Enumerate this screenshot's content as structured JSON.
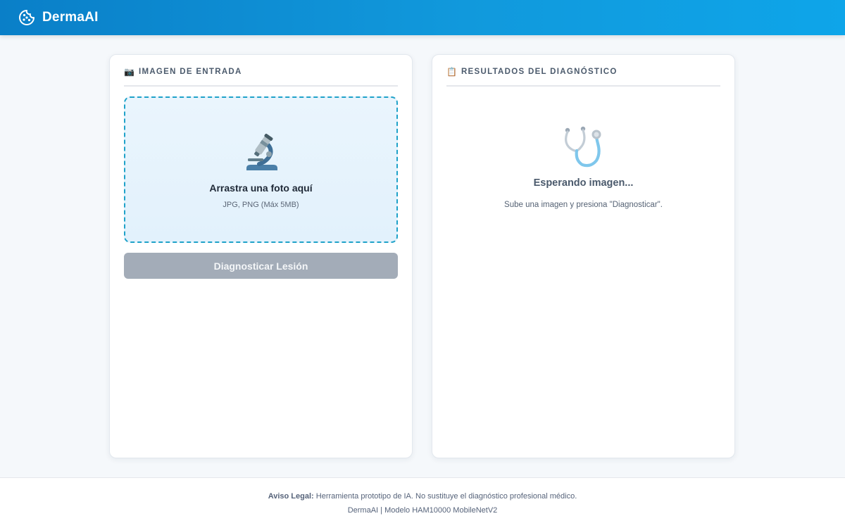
{
  "navbar": {
    "brand_name": "DermaAI",
    "brand_icon": "cookie-icon"
  },
  "input_panel": {
    "header_icon": "📷",
    "title": "IMAGEN DE ENTRADA",
    "dropzone": {
      "icon": "microscope-icon",
      "title": "Arrastra una foto aquí",
      "subtitle": "JPG, PNG (Máx 5MB)"
    },
    "diagnose_button_label": "Diagnosticar Lesión",
    "diagnose_button_state": "disabled"
  },
  "results_panel": {
    "header_icon": "📋",
    "title": "RESULTADOS DEL DIAGNÓSTICO",
    "empty_state": {
      "icon": "stethoscope-icon",
      "title": "Esperando imagen...",
      "subtitle": "Sube una imagen y presiona \"Diagnosticar\"."
    }
  },
  "footer": {
    "disclaimer_label": "Aviso Legal:",
    "disclaimer_text": " Herramienta prototipo de IA. No sustituye el diagnóstico profesional médico.",
    "credits": "DermaAI | Modelo HAM10000 MobileNetV2"
  },
  "colors": {
    "navbar_start": "#0a7fc8",
    "navbar_end": "#0ea5e9",
    "dropzone_border": "#1fa2c9",
    "button_disabled": "#a3acb8"
  }
}
